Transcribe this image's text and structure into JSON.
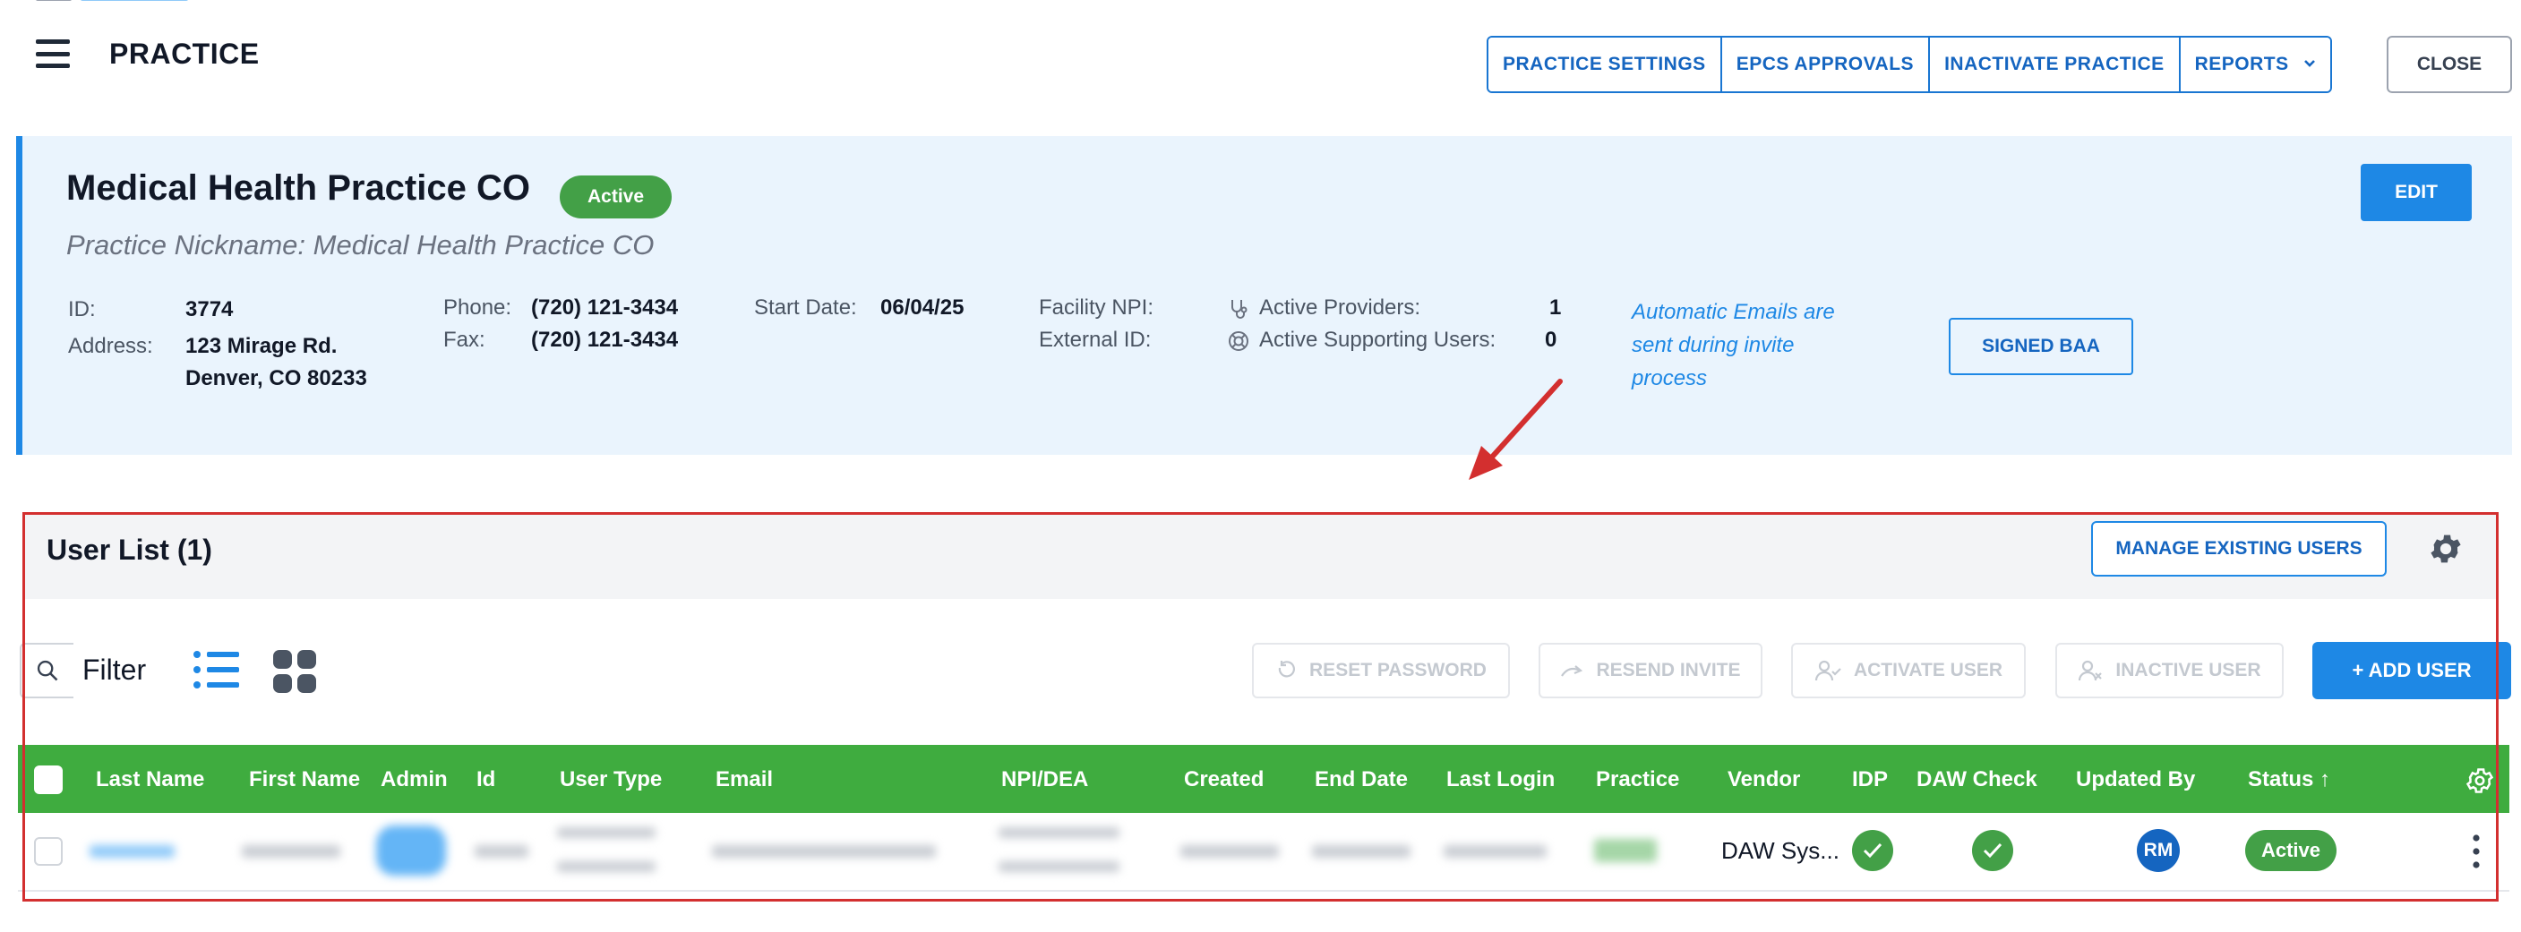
{
  "header": {
    "title": "PRACTICE",
    "actions": [
      "PRACTICE SETTINGS",
      "EPCS APPROVALS",
      "INACTIVATE PRACTICE",
      "REPORTS"
    ],
    "close_label": "CLOSE"
  },
  "practice": {
    "name": "Medical Health Practice CO",
    "status": "Active",
    "nickname": "Practice Nickname: Medical Health Practice CO",
    "id_label": "ID:",
    "id": "3774",
    "address_label": "Address:",
    "address_line1": "123 Mirage Rd.",
    "address_line2": "Denver, CO 80233",
    "phone_label": "Phone:",
    "phone": "(720) 121-3434",
    "fax_label": "Fax:",
    "fax": "(720) 121-3434",
    "start_label": "Start Date:",
    "start_date": "06/04/25",
    "npi_label": "Facility NPI:",
    "external_label": "External ID:",
    "providers_label": "Active Providers:",
    "providers_count": "1",
    "supporting_label": "Active Supporting Users:",
    "supporting_count": "0",
    "auto_email_note_1": "Automatic Emails are",
    "auto_email_note_2": "sent during invite",
    "auto_email_note_3": "process",
    "edit_label": "EDIT",
    "baa_label": "SIGNED BAA"
  },
  "user_list": {
    "title": "User List (1)",
    "manage_label": "MANAGE EXISTING USERS",
    "filter_label": "Filter",
    "reset_password": "RESET PASSWORD",
    "resend_invite": "RESEND INVITE",
    "activate_user": "ACTIVATE USER",
    "inactive_user": "INACTIVE USER",
    "add_user": "+ ADD USER",
    "columns": [
      "Last Name",
      "First Name",
      "Admin",
      "Id",
      "User Type",
      "Email",
      "NPI/DEA",
      "Created",
      "End Date",
      "Last Login",
      "Practice",
      "Vendor",
      "IDP",
      "DAW Check",
      "Updated By",
      "Status ↑"
    ],
    "rows": [
      {
        "vendor": "DAW Sys...",
        "updated_by": "RM",
        "status": "Active"
      }
    ]
  },
  "colors": {
    "accent": "#1e88e5",
    "header_green": "#3fac3f",
    "active_green": "#43a047",
    "highlight_red": "#d32f2f",
    "card_bg": "#eaf4fd"
  },
  "icons": [
    "menu-icon",
    "chevron-down-icon",
    "stethoscope-icon",
    "lifebuoy-icon",
    "gear-icon",
    "search-icon",
    "list-view-icon",
    "grid-view-icon",
    "reset-icon",
    "resend-icon",
    "activate-user-icon",
    "inactive-user-icon",
    "check-icon",
    "more-vert-icon"
  ]
}
